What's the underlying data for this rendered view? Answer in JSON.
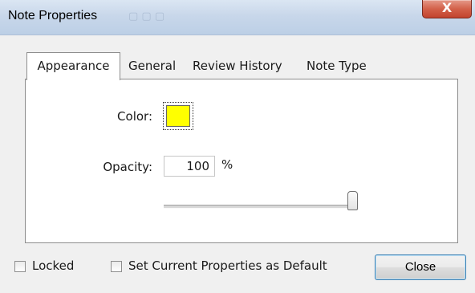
{
  "window": {
    "title": "Note Properties",
    "close_glyph": "X"
  },
  "tabs": [
    {
      "label": "Appearance",
      "active": true
    },
    {
      "label": "General",
      "active": false
    },
    {
      "label": "Review History",
      "active": false
    },
    {
      "label": "Note Type",
      "active": false
    }
  ],
  "appearance": {
    "color_label": "Color:",
    "color_value": "#ffff00",
    "opacity_label": "Opacity:",
    "opacity_value": "100",
    "opacity_unit": "%",
    "opacity_slider_fraction": 1.0
  },
  "footer": {
    "locked_label": "Locked",
    "locked_checked": false,
    "set_default_label": "Set Current Properties as Default",
    "set_default_checked": false,
    "close_label": "Close"
  }
}
